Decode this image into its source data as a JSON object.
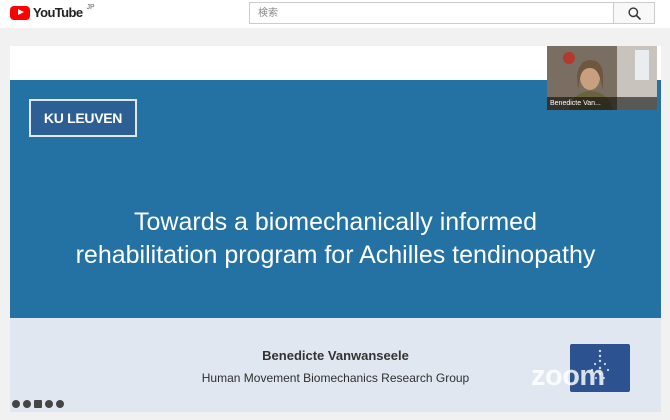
{
  "header": {
    "brand": "YouTube",
    "region": "JP",
    "search_placeholder": "検索"
  },
  "slide": {
    "logo_text": "KU LEUVEN",
    "title_line1": "Towards a biomechanically informed",
    "title_line2": "rehabilitation program for Achilles tendinopathy",
    "author": "Benedicte Vanwanseele",
    "group": "Human Movement Biomechanics Research Group"
  },
  "participant": {
    "name": "Benedicte Van..."
  },
  "watermark": "zoom",
  "colors": {
    "slide_blue": "#2372a3",
    "slide_footer": "#e1e7f1",
    "brand_red": "#ff0000"
  }
}
